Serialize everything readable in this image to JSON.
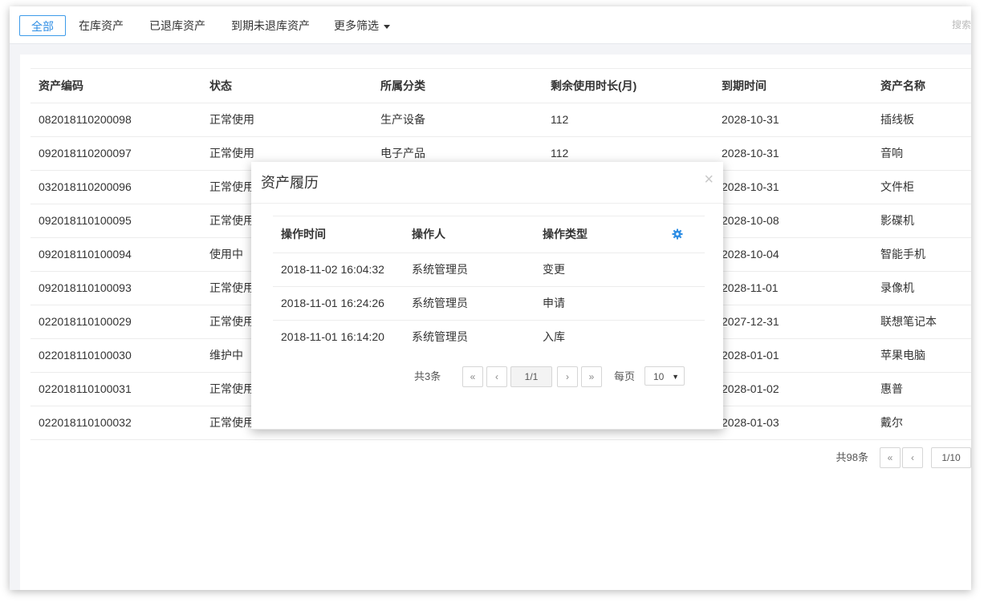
{
  "tabs": [
    {
      "label": "全部",
      "active": true
    },
    {
      "label": "在库资产",
      "active": false
    },
    {
      "label": "已退库资产",
      "active": false
    },
    {
      "label": "到期未退库资产",
      "active": false
    },
    {
      "label": "更多筛选",
      "active": false
    }
  ],
  "search_placeholder": "搜索",
  "table": {
    "headers": [
      "资产编码",
      "状态",
      "所属分类",
      "剩余使用时长(月)",
      "到期时间",
      "资产名称"
    ],
    "rows": [
      [
        "082018110200098",
        "正常使用",
        "生产设备",
        "112",
        "2028-10-31",
        "插线板"
      ],
      [
        "092018110200097",
        "正常使用",
        "电子产品",
        "112",
        "2028-10-31",
        "音响"
      ],
      [
        "032018110200096",
        "正常使用",
        "",
        "",
        "2028-10-31",
        "文件柜"
      ],
      [
        "092018110100095",
        "正常使用",
        "",
        "",
        "2028-10-08",
        "影碟机"
      ],
      [
        "092018110100094",
        "使用中",
        "",
        "",
        "2028-10-04",
        "智能手机"
      ],
      [
        "092018110100093",
        "正常使用",
        "",
        "",
        "2028-11-01",
        "录像机"
      ],
      [
        "022018110100029",
        "正常使用",
        "",
        "",
        "2027-12-31",
        "联想笔记本"
      ],
      [
        "022018110100030",
        "维护中",
        "",
        "",
        "2028-01-01",
        "苹果电脑"
      ],
      [
        "022018110100031",
        "正常使用",
        "",
        "",
        "2028-01-02",
        "惠普"
      ],
      [
        "022018110100032",
        "正常使用",
        "",
        "",
        "2028-01-03",
        "戴尔"
      ]
    ]
  },
  "pagination": {
    "total": "共98条",
    "first": "«",
    "prev": "‹",
    "page": "1/10"
  },
  "modal": {
    "title": "资产履历",
    "close": "×",
    "headers": [
      "操作时间",
      "操作人",
      "操作类型"
    ],
    "rows": [
      [
        "2018-11-02 16:04:32",
        "系统管理员",
        "变更"
      ],
      [
        "2018-11-01 16:24:26",
        "系统管理员",
        "申请"
      ],
      [
        "2018-11-01 16:14:20",
        "系统管理员",
        "入库"
      ]
    ],
    "settings_icon": "gear-icon",
    "pagination": {
      "total": "共3条",
      "first": "«",
      "prev": "‹",
      "page": "1/1",
      "next": "›",
      "last": "»",
      "per_page_label": "每页",
      "per_page": "10",
      "dropdown": "▼"
    }
  },
  "colors": {
    "accent": "#2f8ee4",
    "border": "#d6d6d6",
    "bg": "#f3f4f7"
  }
}
